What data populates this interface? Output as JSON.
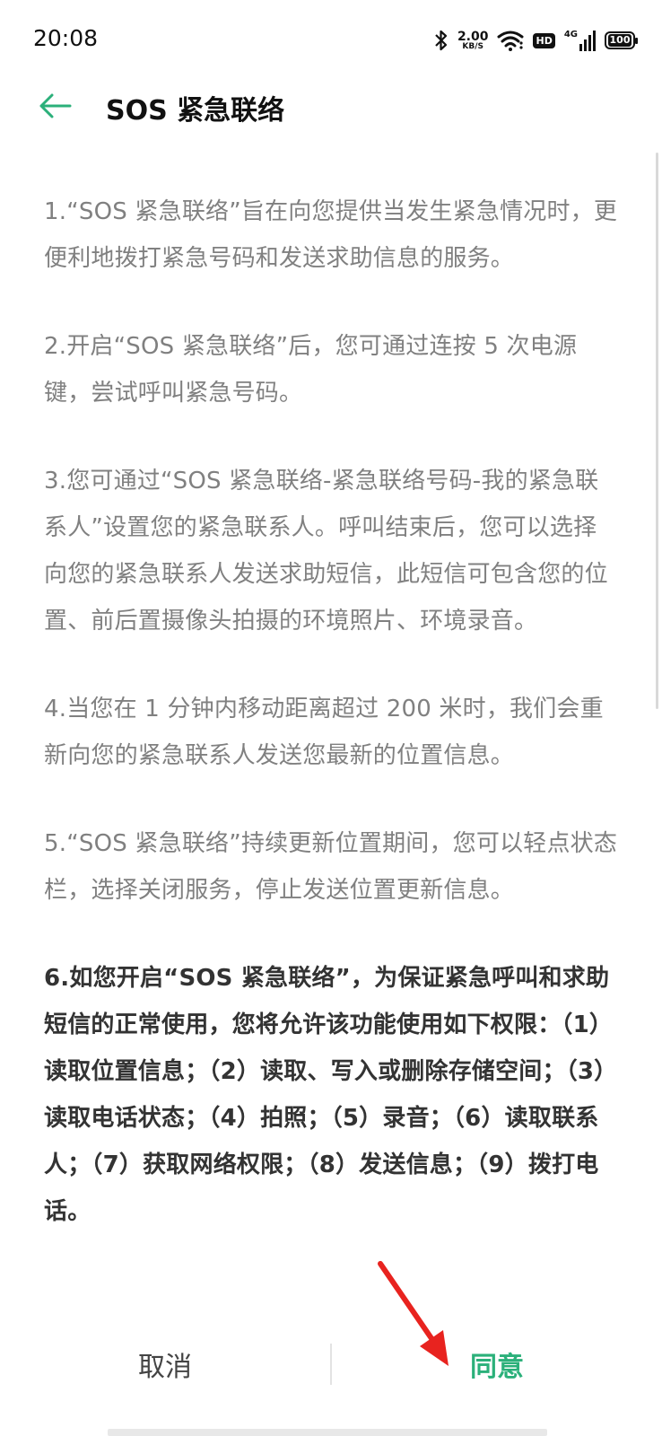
{
  "status_bar": {
    "time": "20:08",
    "speed_value": "2.00",
    "speed_unit": "KB/S",
    "hd_label": "HD",
    "network_label": "4G",
    "battery_level": "100"
  },
  "header": {
    "title": "SOS 紧急联络"
  },
  "content": {
    "paragraphs": [
      "1.“SOS 紧急联络”旨在向您提供当发生紧急情况时，更便利地拨打紧急号码和发送求助信息的服务。",
      "2.开启“SOS 紧急联络”后，您可通过连按 5 次电源键，尝试呼叫紧急号码。",
      "3.您可通过“SOS 紧急联络-紧急联络号码-我的紧急联系人”设置您的紧急联系人。呼叫结束后，您可以选择向您的紧急联系人发送求助短信，此短信可包含您的位置、前后置摄像头拍摄的环境照片、环境录音。",
      "4.当您在 1 分钟内移动距离超过 200 米时，我们会重新向您的紧急联系人发送您最新的位置信息。",
      "5.“SOS 紧急联络”持续更新位置期间，您可以轻点状态栏，选择关闭服务，停止发送位置更新信息。",
      "6.如您开启“SOS 紧急联络”，为保证紧急呼叫和求助短信的正常使用，您将允许该功能使用如下权限：（1）读取位置信息；（2）读取、写入或删除存储空间；（3）读取电话状态；（4）拍照；（5）录音；（6）读取联系人；（7）获取网络权限；（8）发送信息；（9）拨打电话。"
    ]
  },
  "buttons": {
    "cancel": "取消",
    "agree": "同意"
  },
  "colors": {
    "accent": "#2bb07a",
    "annotation": "#e8231f"
  }
}
